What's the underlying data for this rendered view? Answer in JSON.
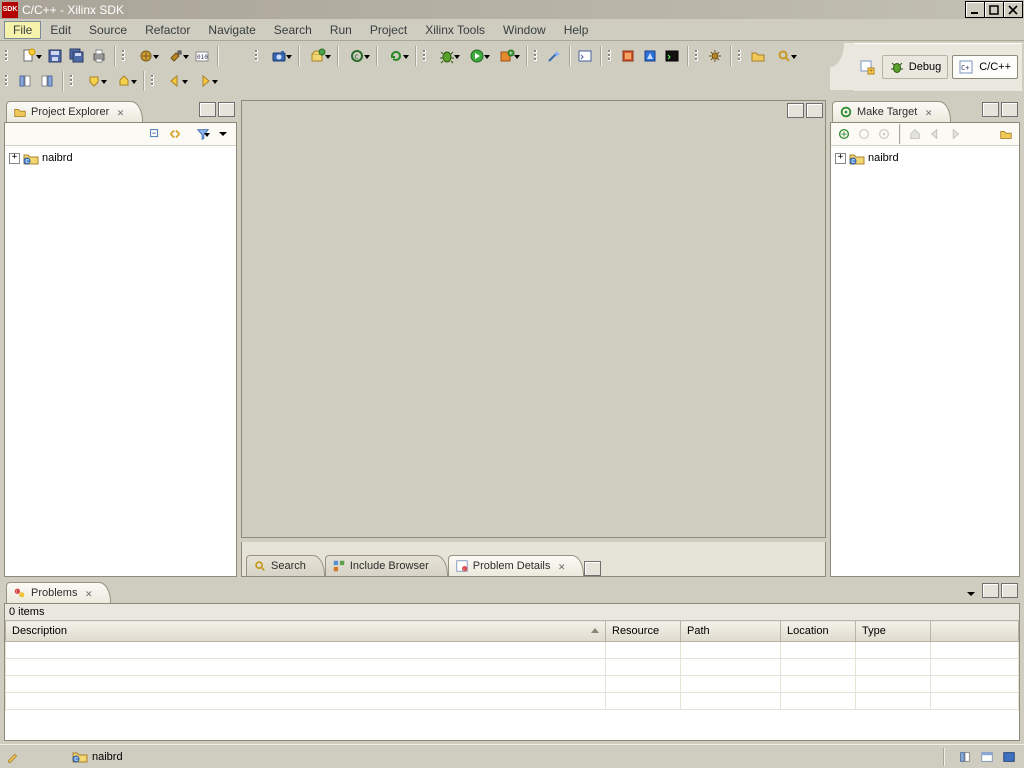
{
  "titlebar": {
    "title": "C/C++ - Xilinx SDK",
    "logo_text": "SDK"
  },
  "menu": {
    "items": [
      "File",
      "Edit",
      "Source",
      "Refactor",
      "Navigate",
      "Search",
      "Run",
      "Project",
      "Xilinx Tools",
      "Window",
      "Help"
    ],
    "active_index": 0
  },
  "perspectives": {
    "debug_label": "Debug",
    "cpp_label": "C/C++"
  },
  "project_explorer": {
    "title": "Project Explorer",
    "tree": [
      {
        "label": "naibrd"
      }
    ]
  },
  "make_target": {
    "title": "Make Target",
    "tree": [
      {
        "label": "naibrd"
      }
    ]
  },
  "mid_tabs": {
    "items": [
      {
        "label": "Search",
        "icon": "search"
      },
      {
        "label": "Include Browser",
        "icon": "include-browser"
      },
      {
        "label": "Problem Details",
        "icon": "problem-details",
        "active": true
      }
    ]
  },
  "problems": {
    "title": "Problems",
    "count_text": "0 items",
    "columns": [
      "Description",
      "Resource",
      "Path",
      "Location",
      "Type",
      ""
    ]
  },
  "statusbar": {
    "project": "naibrd"
  }
}
